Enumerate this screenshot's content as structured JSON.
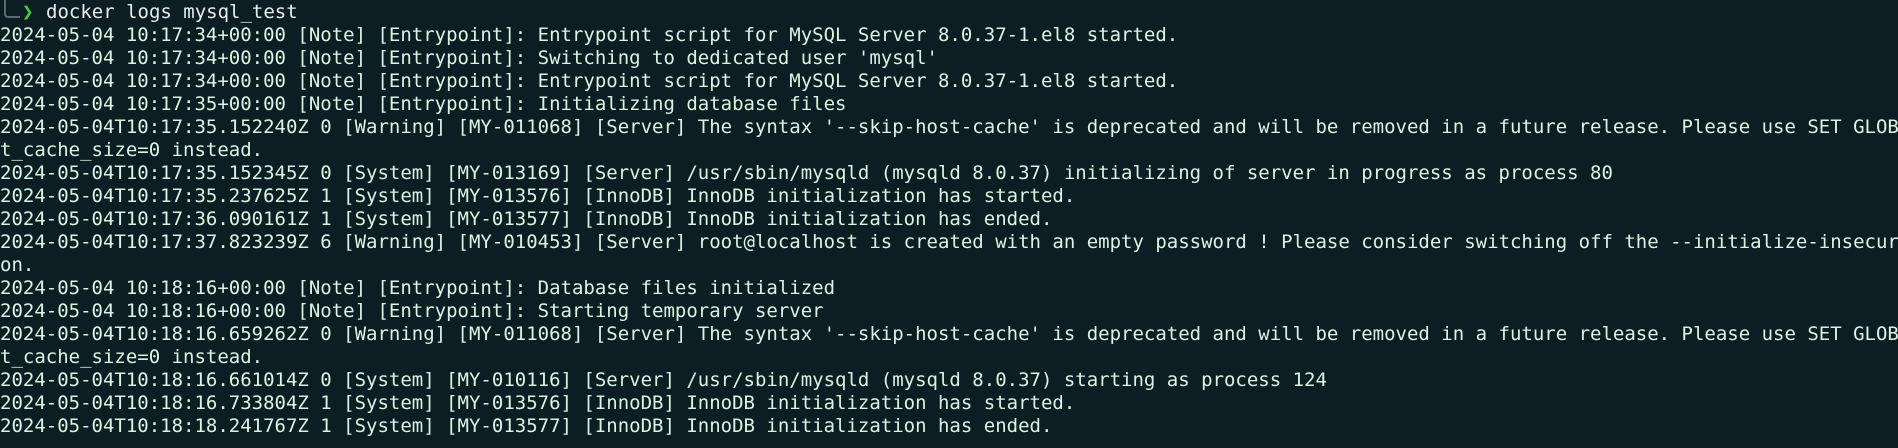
{
  "terminal": {
    "prompt": {
      "chevron": "❯",
      "command": "docker logs mysql_test"
    },
    "lines": [
      "2024-05-04 10:17:34+00:00 [Note] [Entrypoint]: Entrypoint script for MySQL Server 8.0.37-1.el8 started.",
      "2024-05-04 10:17:34+00:00 [Note] [Entrypoint]: Switching to dedicated user 'mysql'",
      "2024-05-04 10:17:34+00:00 [Note] [Entrypoint]: Entrypoint script for MySQL Server 8.0.37-1.el8 started.",
      "2024-05-04 10:17:35+00:00 [Note] [Entrypoint]: Initializing database files",
      "2024-05-04T10:17:35.152240Z 0 [Warning] [MY-011068] [Server] The syntax '--skip-host-cache' is deprecated and will be removed in a future release. Please use SET GLOBAL hos",
      "t_cache_size=0 instead.",
      "2024-05-04T10:17:35.152345Z 0 [System] [MY-013169] [Server] /usr/sbin/mysqld (mysqld 8.0.37) initializing of server in progress as process 80",
      "2024-05-04T10:17:35.237625Z 1 [System] [MY-013576] [InnoDB] InnoDB initialization has started.",
      "2024-05-04T10:17:36.090161Z 1 [System] [MY-013577] [InnoDB] InnoDB initialization has ended.",
      "2024-05-04T10:17:37.823239Z 6 [Warning] [MY-010453] [Server] root@localhost is created with an empty password ! Please consider switching off the --initialize-insecure opti",
      "on.",
      "2024-05-04 10:18:16+00:00 [Note] [Entrypoint]: Database files initialized",
      "2024-05-04 10:18:16+00:00 [Note] [Entrypoint]: Starting temporary server",
      "2024-05-04T10:18:16.659262Z 0 [Warning] [MY-011068] [Server] The syntax '--skip-host-cache' is deprecated and will be removed in a future release. Please use SET GLOBAL hos",
      "t_cache_size=0 instead.",
      "2024-05-04T10:18:16.661014Z 0 [System] [MY-010116] [Server] /usr/sbin/mysqld (mysqld 8.0.37) starting as process 124",
      "2024-05-04T10:18:16.733804Z 1 [System] [MY-013576] [InnoDB] InnoDB initialization has started.",
      "2024-05-04T10:18:18.241767Z 1 [System] [MY-013577] [InnoDB] InnoDB initialization has ended."
    ],
    "colors": {
      "background": "#0c1d24",
      "prompt_chevron": "#3fd13f",
      "output_text": "#d9f5e0"
    }
  }
}
